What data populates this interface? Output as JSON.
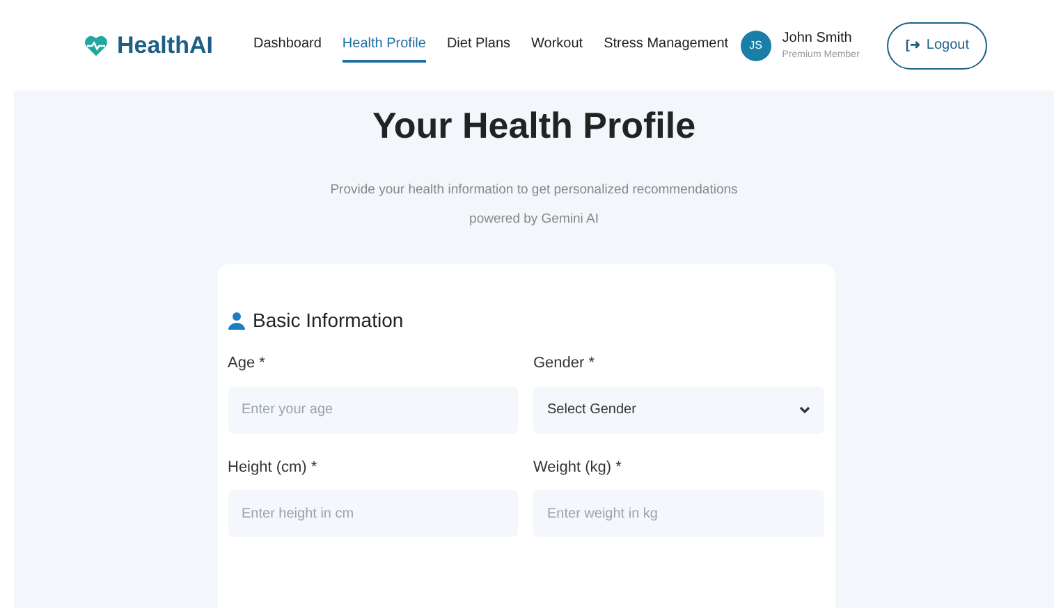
{
  "brand": "HealthAI",
  "nav": [
    {
      "label": "Dashboard",
      "selected": false
    },
    {
      "label": "Health Profile",
      "selected": true
    },
    {
      "label": "Diet Plans",
      "selected": false
    },
    {
      "label": "Workout",
      "selected": false
    },
    {
      "label": "Stress Management",
      "selected": false
    }
  ],
  "user": {
    "initials": "JS",
    "name": "John Smith",
    "plan": "Premium Member"
  },
  "logout": {
    "icon": "[➜",
    "label": "Logout"
  },
  "page": {
    "title": "Your Health Profile",
    "subtitle": "Provide your health information to get personalized recommendations powered by Gemini AI"
  },
  "section": {
    "title": "Basic Information",
    "fields": [
      {
        "label": "Age *",
        "kind": "input",
        "placeholder": "Enter your age"
      },
      {
        "label": "Gender *",
        "kind": "select",
        "value": "Select Gender"
      },
      {
        "label": "Height (cm) *",
        "kind": "input",
        "placeholder": "Enter height in cm"
      },
      {
        "label": "Weight (kg) *",
        "kind": "input",
        "placeholder": "Enter weight in kg"
      }
    ]
  }
}
